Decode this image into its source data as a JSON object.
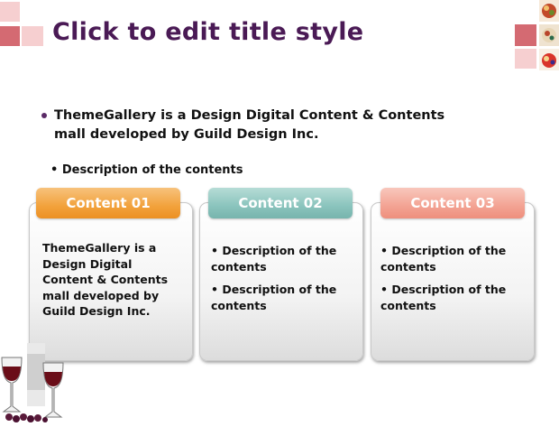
{
  "slide": {
    "title": "Click to edit title style",
    "bullet_main": "ThemeGallery  is a Design Digital Content & Contents mall developed by Guild Design Inc.",
    "bullet_sub": "• Description of the contents"
  },
  "cards": [
    {
      "header": "Content 01",
      "body": "ThemeGallery is a Design Digital Content & Contents mall developed by Guild Design Inc."
    },
    {
      "header": "Content 02",
      "items": [
        "• Description of the contents",
        "• Description of the contents"
      ]
    },
    {
      "header": "Content 03",
      "items": [
        "• Description of the contents",
        "• Description of the contents"
      ]
    }
  ],
  "colors": {
    "title": "#4a1a55",
    "header_01": "#f2a23c",
    "header_02": "#8ac4bd",
    "header_03": "#f3a393",
    "accent_square_dark": "#d46a72",
    "accent_square_light": "#f6cfd0"
  },
  "icons": [
    "food-photo-icon",
    "wine-glasses-photo-icon"
  ]
}
